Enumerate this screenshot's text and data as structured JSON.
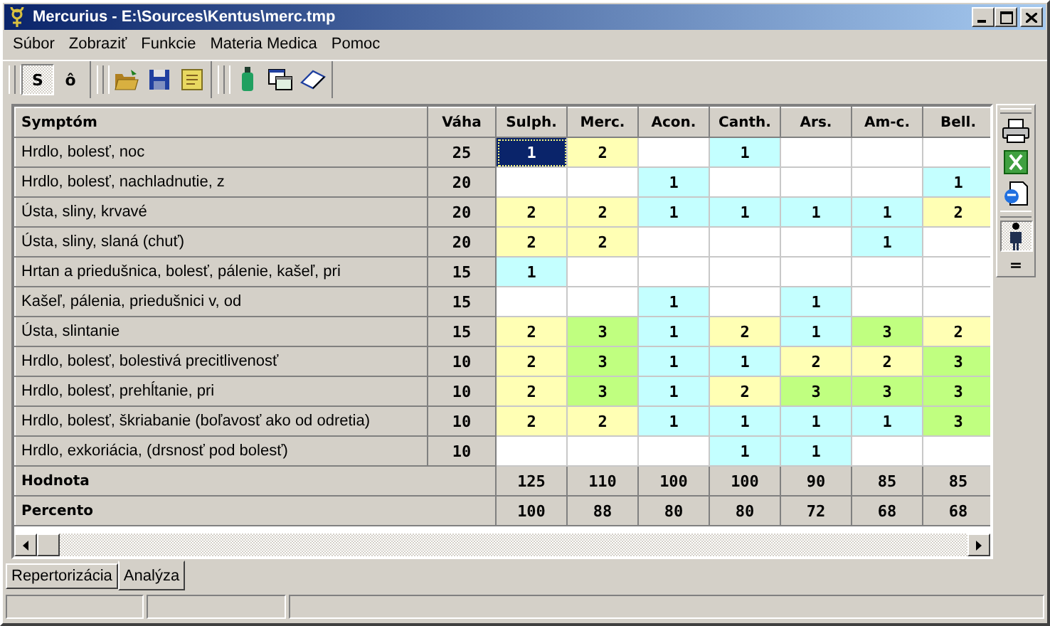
{
  "window": {
    "title": "Mercurius - E:\\Sources\\Kentus\\merc.tmp"
  },
  "menu": [
    {
      "label": "Súbor"
    },
    {
      "label": "Zobraziť"
    },
    {
      "label": "Funkcie"
    },
    {
      "label": "Materia Medica"
    },
    {
      "label": "Pomoc"
    }
  ],
  "toolbar_toggles": [
    {
      "text": "S",
      "pressed": true
    },
    {
      "text": "ô",
      "pressed": false
    }
  ],
  "side_toolbar": {
    "filter_toggle": {
      "pressed": true
    },
    "equals_button": {
      "text": "="
    }
  },
  "table": {
    "columns": [
      {
        "label": "Symptóm"
      },
      {
        "label": "Váha"
      },
      {
        "label": "Sulph."
      },
      {
        "label": "Merc."
      },
      {
        "label": "Acon."
      },
      {
        "label": "Canth."
      },
      {
        "label": "Ars."
      },
      {
        "label": "Am-c."
      },
      {
        "label": "Bell."
      }
    ],
    "rows": [
      {
        "cells": [
          {
            "kind": "symptom",
            "text": "Hrdlo, bolesť, noc"
          },
          {
            "kind": "weight",
            "text": "25"
          },
          {
            "kind": "grade",
            "text": "1",
            "color": "#0a246a",
            "selected": true
          },
          {
            "kind": "grade",
            "text": "2",
            "color": "#ffffb4",
            "selected": false
          },
          {
            "kind": "grade",
            "color": "#ffffff",
            "selected": false
          },
          {
            "kind": "grade",
            "text": "1",
            "color": "#c4ffff",
            "selected": false
          },
          {
            "kind": "grade",
            "color": "#ffffff",
            "selected": false
          },
          {
            "kind": "grade",
            "color": "#ffffff",
            "selected": false
          },
          {
            "kind": "grade",
            "color": "#ffffff",
            "selected": false
          }
        ]
      },
      {
        "cells": [
          {
            "kind": "symptom",
            "text": "Hrdlo, bolesť, nachladnutie, z"
          },
          {
            "kind": "weight",
            "text": "20"
          },
          {
            "kind": "grade",
            "color": "#ffffff",
            "selected": false
          },
          {
            "kind": "grade",
            "color": "#ffffff",
            "selected": false
          },
          {
            "kind": "grade",
            "text": "1",
            "color": "#c4ffff",
            "selected": false
          },
          {
            "kind": "grade",
            "color": "#ffffff",
            "selected": false
          },
          {
            "kind": "grade",
            "color": "#ffffff",
            "selected": false
          },
          {
            "kind": "grade",
            "color": "#ffffff",
            "selected": false
          },
          {
            "kind": "grade",
            "text": "1",
            "color": "#c4ffff",
            "selected": false
          }
        ]
      },
      {
        "cells": [
          {
            "kind": "symptom",
            "text": "Ústa, sliny, krvavé"
          },
          {
            "kind": "weight",
            "text": "20"
          },
          {
            "kind": "grade",
            "text": "2",
            "color": "#ffffb4",
            "selected": false
          },
          {
            "kind": "grade",
            "text": "2",
            "color": "#ffffb4",
            "selected": false
          },
          {
            "kind": "grade",
            "text": "1",
            "color": "#c4ffff",
            "selected": false
          },
          {
            "kind": "grade",
            "text": "1",
            "color": "#c4ffff",
            "selected": false
          },
          {
            "kind": "grade",
            "text": "1",
            "color": "#c4ffff",
            "selected": false
          },
          {
            "kind": "grade",
            "text": "1",
            "color": "#c4ffff",
            "selected": false
          },
          {
            "kind": "grade",
            "text": "2",
            "color": "#ffffb4",
            "selected": false
          }
        ]
      },
      {
        "cells": [
          {
            "kind": "symptom",
            "text": "Ústa, sliny, slaná (chuť)"
          },
          {
            "kind": "weight",
            "text": "20"
          },
          {
            "kind": "grade",
            "text": "2",
            "color": "#ffffb4",
            "selected": false
          },
          {
            "kind": "grade",
            "text": "2",
            "color": "#ffffb4",
            "selected": false
          },
          {
            "kind": "grade",
            "color": "#ffffff",
            "selected": false
          },
          {
            "kind": "grade",
            "color": "#ffffff",
            "selected": false
          },
          {
            "kind": "grade",
            "color": "#ffffff",
            "selected": false
          },
          {
            "kind": "grade",
            "text": "1",
            "color": "#c4ffff",
            "selected": false
          },
          {
            "kind": "grade",
            "color": "#ffffff",
            "selected": false
          }
        ]
      },
      {
        "cells": [
          {
            "kind": "symptom",
            "text": "Hrtan a priedušnica, bolesť, pálenie, kašeľ, pri"
          },
          {
            "kind": "weight",
            "text": "15"
          },
          {
            "kind": "grade",
            "text": "1",
            "color": "#c4ffff",
            "selected": false
          },
          {
            "kind": "grade",
            "color": "#ffffff",
            "selected": false
          },
          {
            "kind": "grade",
            "color": "#ffffff",
            "selected": false
          },
          {
            "kind": "grade",
            "color": "#ffffff",
            "selected": false
          },
          {
            "kind": "grade",
            "color": "#ffffff",
            "selected": false
          },
          {
            "kind": "grade",
            "color": "#ffffff",
            "selected": false
          },
          {
            "kind": "grade",
            "color": "#ffffff",
            "selected": false
          }
        ]
      },
      {
        "cells": [
          {
            "kind": "symptom",
            "text": "Kašeľ, pálenia, priedušnici v, od"
          },
          {
            "kind": "weight",
            "text": "15"
          },
          {
            "kind": "grade",
            "color": "#ffffff",
            "selected": false
          },
          {
            "kind": "grade",
            "color": "#ffffff",
            "selected": false
          },
          {
            "kind": "grade",
            "text": "1",
            "color": "#c4ffff",
            "selected": false
          },
          {
            "kind": "grade",
            "color": "#ffffff",
            "selected": false
          },
          {
            "kind": "grade",
            "text": "1",
            "color": "#c4ffff",
            "selected": false
          },
          {
            "kind": "grade",
            "color": "#ffffff",
            "selected": false
          },
          {
            "kind": "grade",
            "color": "#ffffff",
            "selected": false
          }
        ]
      },
      {
        "cells": [
          {
            "kind": "symptom",
            "text": "Ústa, slintanie"
          },
          {
            "kind": "weight",
            "text": "15"
          },
          {
            "kind": "grade",
            "text": "2",
            "color": "#ffffb4",
            "selected": false
          },
          {
            "kind": "grade",
            "text": "3",
            "color": "#c0ff80",
            "selected": false
          },
          {
            "kind": "grade",
            "text": "1",
            "color": "#c4ffff",
            "selected": false
          },
          {
            "kind": "grade",
            "text": "2",
            "color": "#ffffb4",
            "selected": false
          },
          {
            "kind": "grade",
            "text": "1",
            "color": "#c4ffff",
            "selected": false
          },
          {
            "kind": "grade",
            "text": "3",
            "color": "#c0ff80",
            "selected": false
          },
          {
            "kind": "grade",
            "text": "2",
            "color": "#ffffb4",
            "selected": false
          }
        ]
      },
      {
        "cells": [
          {
            "kind": "symptom",
            "text": "Hrdlo, bolesť, bolestivá precitlivenosť"
          },
          {
            "kind": "weight",
            "text": "10"
          },
          {
            "kind": "grade",
            "text": "2",
            "color": "#ffffb4",
            "selected": false
          },
          {
            "kind": "grade",
            "text": "3",
            "color": "#c0ff80",
            "selected": false
          },
          {
            "kind": "grade",
            "text": "1",
            "color": "#c4ffff",
            "selected": false
          },
          {
            "kind": "grade",
            "text": "1",
            "color": "#c4ffff",
            "selected": false
          },
          {
            "kind": "grade",
            "text": "2",
            "color": "#ffffb4",
            "selected": false
          },
          {
            "kind": "grade",
            "text": "2",
            "color": "#ffffb4",
            "selected": false
          },
          {
            "kind": "grade",
            "text": "3",
            "color": "#c0ff80",
            "selected": false
          }
        ]
      },
      {
        "cells": [
          {
            "kind": "symptom",
            "text": "Hrdlo, bolesť, prehĺtanie, pri"
          },
          {
            "kind": "weight",
            "text": "10"
          },
          {
            "kind": "grade",
            "text": "2",
            "color": "#ffffb4",
            "selected": false
          },
          {
            "kind": "grade",
            "text": "3",
            "color": "#c0ff80",
            "selected": false
          },
          {
            "kind": "grade",
            "text": "1",
            "color": "#c4ffff",
            "selected": false
          },
          {
            "kind": "grade",
            "text": "2",
            "color": "#ffffb4",
            "selected": false
          },
          {
            "kind": "grade",
            "text": "3",
            "color": "#c0ff80",
            "selected": false
          },
          {
            "kind": "grade",
            "text": "3",
            "color": "#c0ff80",
            "selected": false
          },
          {
            "kind": "grade",
            "text": "3",
            "color": "#c0ff80",
            "selected": false
          }
        ]
      },
      {
        "cells": [
          {
            "kind": "symptom",
            "text": "Hrdlo, bolesť, škriabanie (boľavosť ako od odretia)"
          },
          {
            "kind": "weight",
            "text": "10"
          },
          {
            "kind": "grade",
            "text": "2",
            "color": "#ffffb4",
            "selected": false
          },
          {
            "kind": "grade",
            "text": "2",
            "color": "#ffffb4",
            "selected": false
          },
          {
            "kind": "grade",
            "text": "1",
            "color": "#c4ffff",
            "selected": false
          },
          {
            "kind": "grade",
            "text": "1",
            "color": "#c4ffff",
            "selected": false
          },
          {
            "kind": "grade",
            "text": "1",
            "color": "#c4ffff",
            "selected": false
          },
          {
            "kind": "grade",
            "text": "1",
            "color": "#c4ffff",
            "selected": false
          },
          {
            "kind": "grade",
            "text": "3",
            "color": "#c0ff80",
            "selected": false
          }
        ]
      },
      {
        "cells": [
          {
            "kind": "symptom",
            "text": "Hrdlo, exkoriácia, (drsnosť pod bolesť)"
          },
          {
            "kind": "weight",
            "text": "10"
          },
          {
            "kind": "grade",
            "color": "#ffffff",
            "selected": false
          },
          {
            "kind": "grade",
            "color": "#ffffff",
            "selected": false
          },
          {
            "kind": "grade",
            "color": "#ffffff",
            "selected": false
          },
          {
            "kind": "grade",
            "text": "1",
            "color": "#c4ffff",
            "selected": false
          },
          {
            "kind": "grade",
            "text": "1",
            "color": "#c4ffff",
            "selected": false
          },
          {
            "kind": "grade",
            "color": "#ffffff",
            "selected": false
          },
          {
            "kind": "grade",
            "color": "#ffffff",
            "selected": false
          }
        ]
      }
    ],
    "summary_rows": [
      {
        "cells": [
          {
            "kind": "label",
            "text": "Hodnota"
          },
          {
            "text": "125"
          },
          {
            "text": "110"
          },
          {
            "text": "100"
          },
          {
            "text": "100"
          },
          {
            "text": "90"
          },
          {
            "text": "85"
          },
          {
            "text": "85"
          }
        ]
      },
      {
        "cells": [
          {
            "kind": "label",
            "text": "Percento"
          },
          {
            "text": "100"
          },
          {
            "text": "88"
          },
          {
            "text": "80"
          },
          {
            "text": "80"
          },
          {
            "text": "72"
          },
          {
            "text": "68"
          },
          {
            "text": "68"
          }
        ]
      }
    ]
  },
  "tabs": [
    {
      "label": "Repertorizácia",
      "selected": false
    },
    {
      "label": "Analýza",
      "selected": true
    }
  ]
}
